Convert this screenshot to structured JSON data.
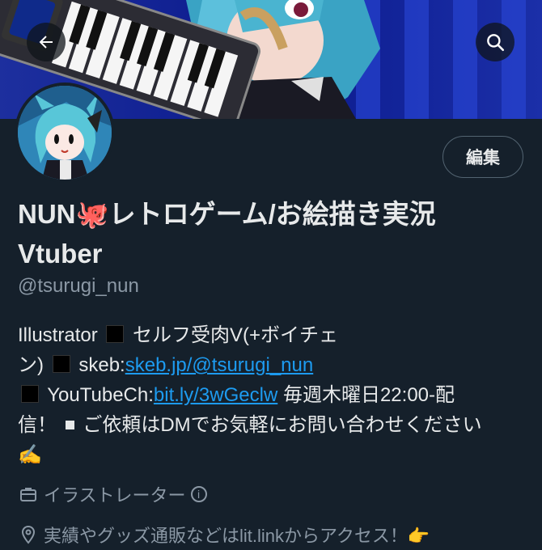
{
  "profile": {
    "display_name_line1": "NUN🐙レトロゲーム/お絵描き実況",
    "display_name_line2": "Vtuber",
    "handle": "@tsurugi_nun",
    "edit_label": "編集"
  },
  "bio": {
    "part1": "Illustrator",
    "part2": "セルフ受肉V(+ボイチェ",
    "part3": "ン)",
    "part4": "skeb:",
    "link_skeb": "skeb.jp/@tsurugi_nun",
    "part5": "YouTubeCh:",
    "link_youtube": "bit.ly/3wGeclw",
    "part6": "毎週木曜日22:00-配",
    "part7": "信！",
    "part8": "ご依頼はDMでお気軽にお問い合わせください",
    "emoji": "✍️"
  },
  "meta": {
    "work": "イラストレーター",
    "info_glyph": "i",
    "location": "実績やグッズ通販などはlit.linkからアクセス！👉"
  },
  "icons": {
    "back": "arrow-left-icon",
    "search": "search-icon",
    "briefcase": "briefcase-icon",
    "location": "location-pin-icon",
    "info": "info-icon"
  },
  "colors": {
    "background": "#15202b",
    "text": "#e7e9ea",
    "secondary": "#8b98a5",
    "link": "#1d9bf0",
    "banner": "#0a1a8a"
  }
}
